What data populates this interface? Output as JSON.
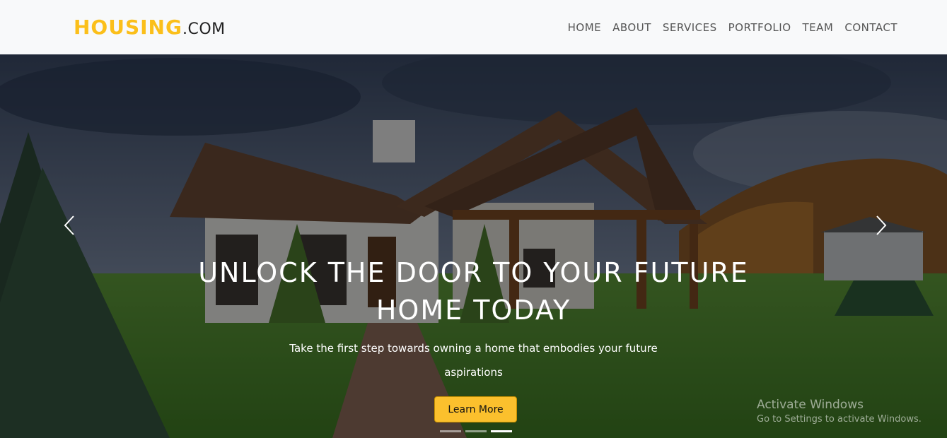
{
  "brand": {
    "main": "HOUSING",
    "suffix": ".COM",
    "accent_color": "#fbbf1a"
  },
  "nav": {
    "items": [
      {
        "label": "HOME"
      },
      {
        "label": "ABOUT"
      },
      {
        "label": "SERVICES"
      },
      {
        "label": "PORTFOLIO"
      },
      {
        "label": "TEAM"
      },
      {
        "label": "CONTACT"
      }
    ]
  },
  "hero": {
    "title": "UNLOCK THE DOOR TO YOUR FUTURE HOME TODAY",
    "subtitle": "Take the first step towards owning a home that embodies your future aspirations",
    "cta_label": "Learn More",
    "cta_color": "#fbc02d",
    "prev_icon": "chevron-left-icon",
    "next_icon": "chevron-right-icon",
    "slide_count": 3,
    "active_slide": 3
  },
  "watermark": {
    "title": "Activate Windows",
    "subtitle": "Go to Settings to activate Windows."
  }
}
